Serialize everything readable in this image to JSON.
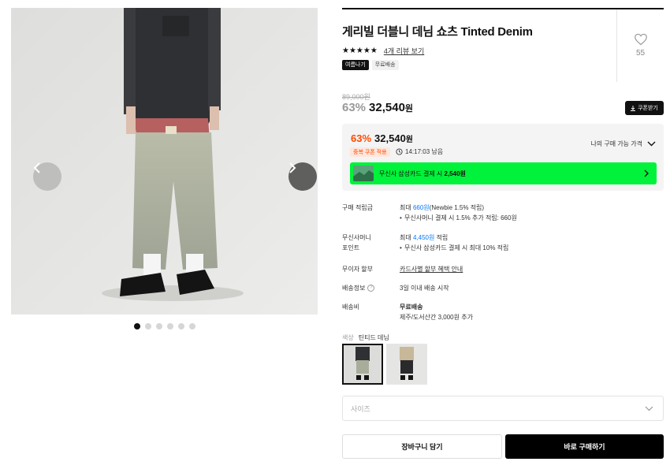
{
  "gallery": {
    "image_label": "product-photo",
    "dot_count": 6,
    "active_index": 0
  },
  "product": {
    "title": "게리빌 더블니 데님 쇼츠 Tinted Denim",
    "stars": "★★★★★",
    "review_link": "4개 리뷰 보기",
    "badges": [
      "여름나기",
      "무료배송"
    ],
    "like_count": "55"
  },
  "price": {
    "original": "89,000원",
    "discount": "63%",
    "current": "32,540",
    "currency": "원",
    "coupon_button": "쿠폰받기"
  },
  "best_price": {
    "discount": "63%",
    "amount": "32,540",
    "currency": "원",
    "dup_coupon": "중복 쿠폰 적용",
    "timer": "14:17:03 남음",
    "my_price": "나의 구매 가능 가격",
    "card_banner_prefix": "무신사 삼성카드 결제 시 ",
    "card_banner_amount": "2,540원"
  },
  "info": {
    "points_label": "구매 적립금",
    "points_prefix": "최대 ",
    "points_amount": "660원",
    "points_suffix": "(Newbie 1.5% 적립)",
    "points_bullet": "무신사머니 결제 시 1.5% 추가 적립: 660원",
    "money_label_1": "무신사머니",
    "money_label_2": "포인트",
    "money_prefix": "최대 ",
    "money_amount": "4,450원",
    "money_suffix": " 적립",
    "money_bullet": "무신사 삼성카드 결제 시 최대 10% 적립",
    "installment_label": "무이자 할부",
    "installment_link": "카드사별 할부 혜택 안내",
    "shipping_info_label": "배송정보",
    "shipping_info_help": "?",
    "shipping_info_value": "3일 이내 배송 시작",
    "shipping_fee_label": "배송비",
    "shipping_fee_value": "무료배송",
    "shipping_fee_extra": "제주/도서산간 3,000원 추가"
  },
  "options": {
    "color_label": "색상",
    "color_value": "틴티드 데님",
    "size_placeholder": "사이즈"
  },
  "actions": {
    "cart": "장바구니 담기",
    "buy": "바로 구매하기"
  },
  "colors": {
    "accent_orange": "#ff4b00",
    "link_blue": "#0078ff",
    "card_green": "#00f23a"
  }
}
